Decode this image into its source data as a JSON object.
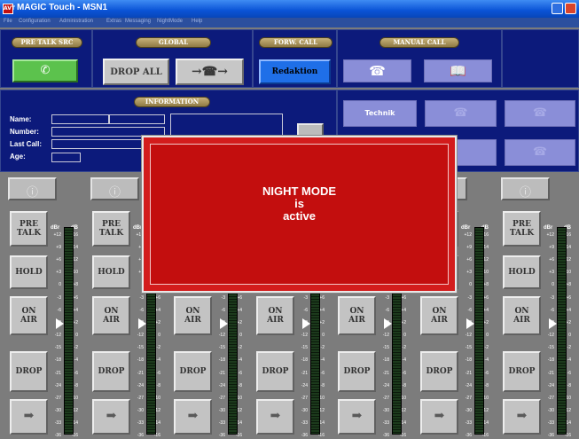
{
  "window": {
    "title": "MAGIC Touch - MSN1",
    "logo_text": "AVT",
    "controls": [
      "minimize",
      "close"
    ]
  },
  "menu": [
    "File",
    "Configuration",
    "Administration",
    "Extras",
    "Messaging",
    "NightMode",
    "Help"
  ],
  "sections": {
    "pre_talk_src": "PRE TALK SRC",
    "global": "GLOBAL",
    "forw_call": "FORW. CALL",
    "manual_call": "MANUAL CALL",
    "information": "INFORMATION"
  },
  "buttons": {
    "drop_all": "DROP ALL",
    "redaktion": "Redaktion",
    "transfer_arrows": "→☎→",
    "technik": "Technik"
  },
  "info": {
    "name_label": "Name:",
    "number_label": "Number:",
    "last_call_label": "Last Call:",
    "age_label": "Age:"
  },
  "channel": {
    "pre_talk": "PRE\nTALK",
    "pre": "PRE",
    "talk": "TALK",
    "hold": "HOLD",
    "on": "ON",
    "air": "AIR",
    "drop": "DROP",
    "dbr": "dBr",
    "db": "dB",
    "scale_dbr": [
      "+12",
      "+9",
      "+6",
      "+3",
      "0",
      "-3",
      "-6",
      "-9",
      "-12",
      "-15",
      "-18",
      "-21",
      "-24",
      "-27",
      "-30",
      "-33",
      "-36"
    ],
    "scale_db": [
      "+16",
      "+14",
      "+12",
      "+10",
      "+8",
      "+6",
      "+4",
      "+2",
      "0",
      "-2",
      "-4",
      "-6",
      "-8",
      "-10",
      "-12",
      "-14",
      "-16"
    ]
  },
  "overlay": {
    "line1": "NIGHT MODE",
    "line2": "is",
    "line3": "active"
  },
  "colors": {
    "panel": "#0c1a7b",
    "accent_blue": "#1f6fe8",
    "overlay_red": "#c30e0e",
    "pill_gold": "#c7b27a"
  }
}
